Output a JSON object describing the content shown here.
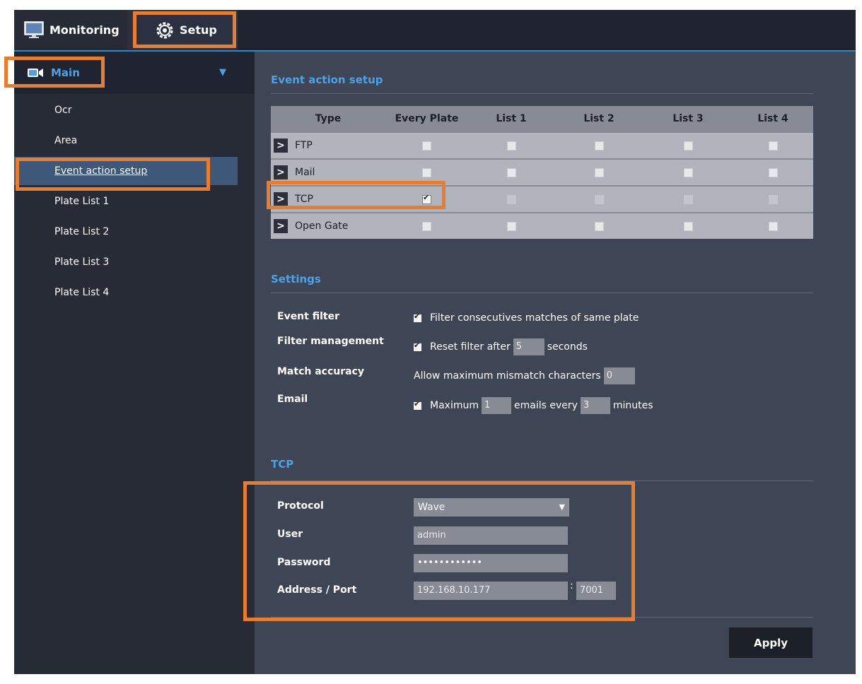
{
  "tabs": {
    "monitoring": "Monitoring",
    "setup": "Setup"
  },
  "sidebar": {
    "main_label": "Main",
    "items": [
      {
        "label": "Ocr"
      },
      {
        "label": "Area"
      },
      {
        "label": "Event action setup"
      },
      {
        "label": "Plate List 1"
      },
      {
        "label": "Plate List 2"
      },
      {
        "label": "Plate List 3"
      },
      {
        "label": "Plate List 4"
      }
    ]
  },
  "event_action": {
    "title": "Event action setup",
    "columns": [
      "Type",
      "Every Plate",
      "List 1",
      "List 2",
      "List 3",
      "List 4"
    ],
    "rows": [
      {
        "type": "FTP",
        "checks": [
          false,
          false,
          false,
          false,
          false
        ]
      },
      {
        "type": "Mail",
        "checks": [
          false,
          false,
          false,
          false,
          false
        ]
      },
      {
        "type": "TCP",
        "checks": [
          true,
          false,
          false,
          false,
          false
        ]
      },
      {
        "type": "Open Gate",
        "checks": [
          false,
          false,
          false,
          false,
          false
        ]
      }
    ]
  },
  "settings": {
    "title": "Settings",
    "event_filter": {
      "label": "Event filter",
      "text": "Filter consecutives matches of same plate"
    },
    "filter_management": {
      "label": "Filter management",
      "text_before": "Reset filter after",
      "value": "5",
      "text_after": "seconds"
    },
    "match_accuracy": {
      "label": "Match accuracy",
      "text": "Allow maximum mismatch characters",
      "value": "0"
    },
    "email": {
      "label": "Email",
      "text_before": "Maximum",
      "value1": "1",
      "text_mid": "emails every",
      "value2": "3",
      "text_after": "minutes"
    }
  },
  "tcp": {
    "title": "TCP",
    "protocol": {
      "label": "Protocol",
      "value": "Wave"
    },
    "user": {
      "label": "User",
      "value": "admin"
    },
    "password": {
      "label": "Password",
      "value": "••••••••••••"
    },
    "address": {
      "label": "Address / Port",
      "value": "192.168.10.177",
      "separator": ":",
      "port": "7001"
    }
  },
  "apply_label": "Apply",
  "colors": {
    "accent": "#4aa3e8",
    "highlight": "#e97d2e"
  }
}
